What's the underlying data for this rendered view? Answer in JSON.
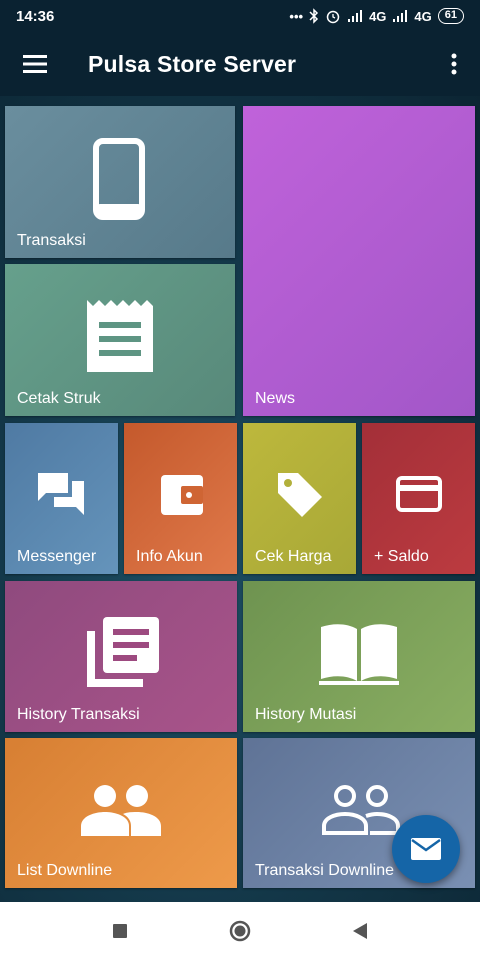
{
  "status_bar": {
    "time": "14:36",
    "signal_1": "4G",
    "signal_2": "4G",
    "battery": "61"
  },
  "app_bar": {
    "title": "Pulsa Store Server",
    "menu_icon": "hamburger-icon",
    "more_icon": "more-vert-icon"
  },
  "tiles": {
    "transaksi": {
      "label": "Transaksi",
      "icon": "phone-icon",
      "color": "#628595"
    },
    "news": {
      "label": "News",
      "icon": "",
      "color": "#b35fd1"
    },
    "cetak_struk": {
      "label": "Cetak Struk",
      "icon": "receipt-icon",
      "color": "#5e9583"
    },
    "messenger": {
      "label": "Messenger",
      "icon": "chat-icon",
      "color": "#5a86ae"
    },
    "info_akun": {
      "label": "Info Akun",
      "icon": "wallet-icon",
      "color": "#cf6534"
    },
    "cek_harga": {
      "label": "Cek Harga",
      "icon": "tag-icon",
      "color": "#b2b03b"
    },
    "saldo": {
      "label": "+ Saldo",
      "icon": "card-icon",
      "color": "#b1353c"
    },
    "history_transaksi": {
      "label": "History Transaksi",
      "icon": "document-stack-icon",
      "color": "#9d4a80"
    },
    "history_mutasi": {
      "label": "History Mutasi",
      "icon": "book-icon",
      "color": "#7e9e58"
    },
    "list_downline": {
      "label": "List Downline",
      "icon": "people-icon",
      "color": "#e68b39"
    },
    "transaksi_downline": {
      "label": "Transaksi Downline",
      "icon": "people-outline-icon",
      "color": "#6a7ea0"
    }
  },
  "fab": {
    "icon": "mail-icon"
  },
  "nav": {
    "recent_icon": "square-icon",
    "home_icon": "circle-icon",
    "back_icon": "triangle-back-icon"
  }
}
